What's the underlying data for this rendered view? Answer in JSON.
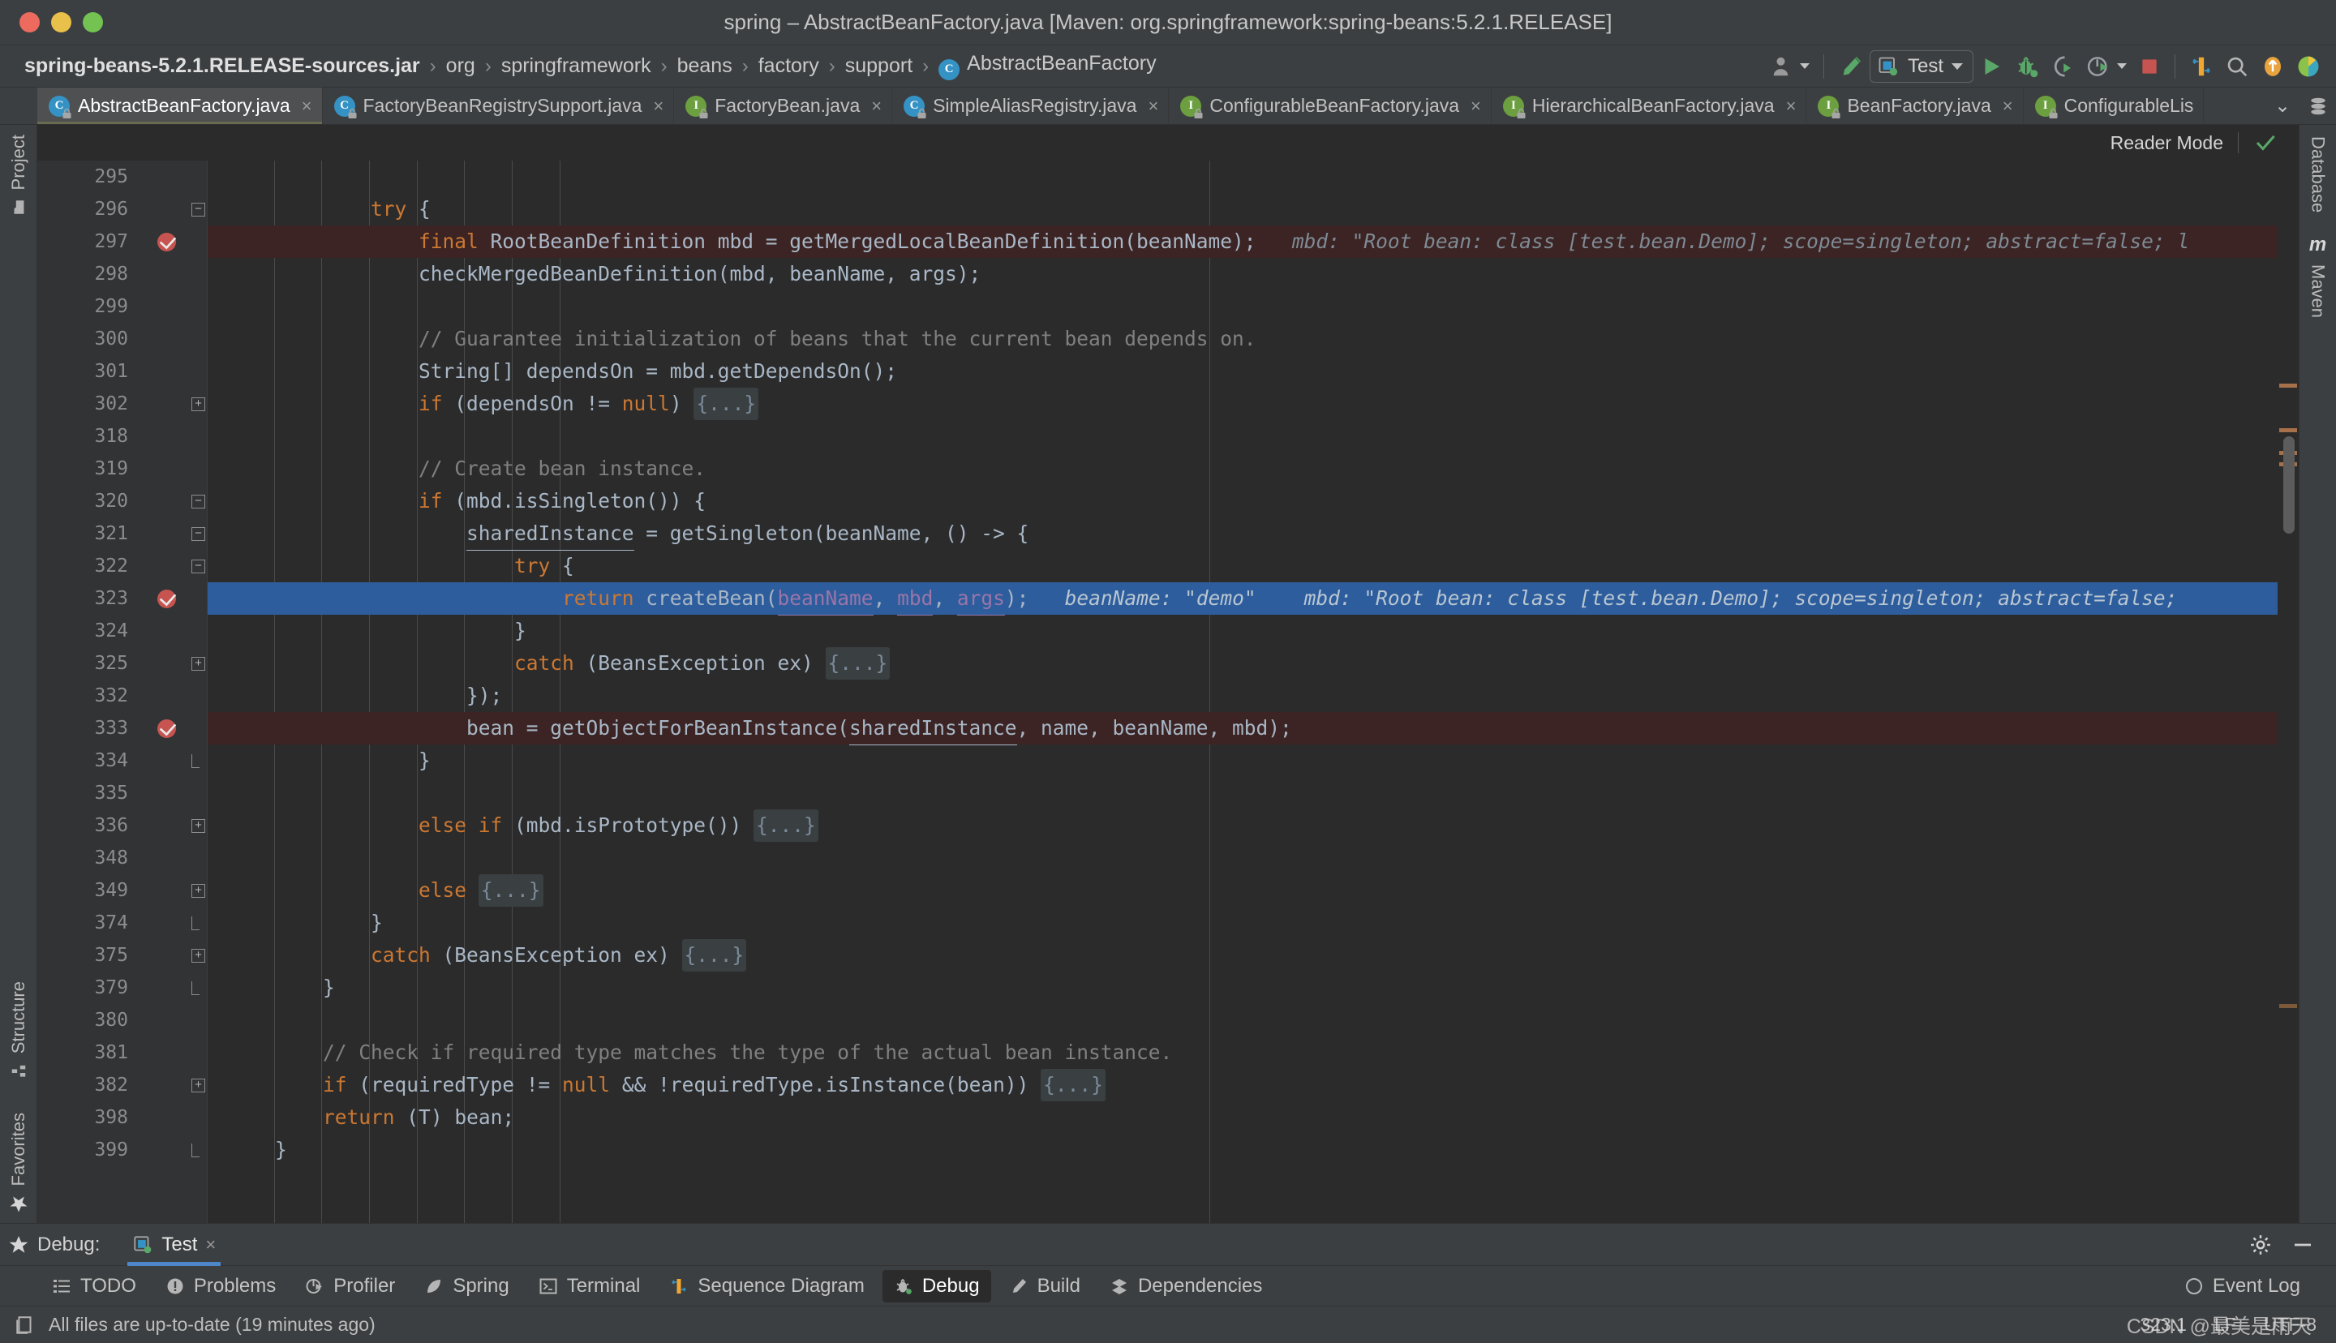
{
  "window": {
    "title": "spring – AbstractBeanFactory.java [Maven: org.springframework:spring-beans:5.2.1.RELEASE]",
    "close_label": "close-window",
    "minimize_label": "minimize-window",
    "maximize_label": "maximize-window"
  },
  "breadcrumb": {
    "items": [
      {
        "label": "spring-beans-5.2.1.RELEASE-sources.jar",
        "icon": "",
        "strong": true
      },
      {
        "label": "org",
        "icon": "",
        "strong": false
      },
      {
        "label": "springframework",
        "icon": "",
        "strong": false
      },
      {
        "label": "beans",
        "icon": "",
        "strong": false
      },
      {
        "label": "factory",
        "icon": "",
        "strong": false
      },
      {
        "label": "support",
        "icon": "",
        "strong": false
      },
      {
        "label": "AbstractBeanFactory",
        "icon": "class-icon",
        "strong": false
      }
    ],
    "separator": "›"
  },
  "toolbar": {
    "user_icon": "user-avatar-icon",
    "build_icon": "build-hammer-icon",
    "run_config": {
      "name": "Test",
      "icon": "run-config-icon"
    },
    "run_icon": "run-play-icon",
    "debug_icon": "debug-bug-icon",
    "run_coverage_icon": "run-with-coverage-icon",
    "profile_icon": "profiler-icon",
    "stop_icon": "stop-square-icon",
    "sequence_icon": "sequence-diagram-icon",
    "search_icon": "search-magnifier-icon",
    "update_icon": "update-project-icon",
    "ide_icon": "ide-feature-icon"
  },
  "tabs": {
    "items": [
      {
        "label": "AbstractBeanFactory.java",
        "kind": "c",
        "active": true,
        "locked": true
      },
      {
        "label": "FactoryBeanRegistrySupport.java",
        "kind": "c",
        "active": false,
        "locked": true
      },
      {
        "label": "FactoryBean.java",
        "kind": "i",
        "active": false,
        "locked": true
      },
      {
        "label": "SimpleAliasRegistry.java",
        "kind": "c",
        "active": false,
        "locked": true
      },
      {
        "label": "ConfigurableBeanFactory.java",
        "kind": "i",
        "active": false,
        "locked": true
      },
      {
        "label": "HierarchicalBeanFactory.java",
        "kind": "i",
        "active": false,
        "locked": true
      },
      {
        "label": "BeanFactory.java",
        "kind": "i",
        "active": false,
        "locked": true
      },
      {
        "label": "ConfigurableLis",
        "kind": "i",
        "active": false,
        "locked": true
      }
    ],
    "close_glyph": "×",
    "more_glyph": "⌄",
    "more_label": "show-hidden-tabs"
  },
  "reader_mode": {
    "label": "Reader Mode",
    "status_icon": "green-check-icon"
  },
  "left_sidebar": {
    "top": [
      {
        "label": "Project",
        "icon": "project-folder-icon"
      }
    ],
    "bottom": [
      {
        "label": "Structure",
        "icon": "structure-icon"
      },
      {
        "label": "Favorites",
        "icon": "favorites-star-icon"
      }
    ]
  },
  "right_sidebar": {
    "items": [
      {
        "label": "Database",
        "icon": "database-icon"
      },
      {
        "label": "Maven",
        "icon": "maven-m-icon"
      }
    ]
  },
  "editor": {
    "lines": [
      {
        "n": "295",
        "indent": 0,
        "state": "normal",
        "breakpoint": false,
        "fold": "",
        "segments": []
      },
      {
        "n": "296",
        "indent": 0,
        "state": "normal",
        "breakpoint": false,
        "fold": "minus",
        "segments": [
          {
            "t": "            ",
            "c": "txt"
          },
          {
            "t": "try",
            "c": "kw"
          },
          {
            "t": " {",
            "c": "txt"
          }
        ]
      },
      {
        "n": "297",
        "indent": 0,
        "state": "err",
        "breakpoint": true,
        "fold": "",
        "segments": [
          {
            "t": "                ",
            "c": "txt"
          },
          {
            "t": "final",
            "c": "kw"
          },
          {
            "t": " RootBeanDefinition mbd = getMergedLocalBeanDefinition(beanName);",
            "c": "txt"
          },
          {
            "t": "   mbd: \"Root bean: class [test.bean.Demo]; scope=singleton; abstract=false; l",
            "c": "hint"
          }
        ]
      },
      {
        "n": "298",
        "indent": 0,
        "state": "normal",
        "breakpoint": false,
        "fold": "",
        "segments": [
          {
            "t": "                checkMergedBeanDefinition(mbd, beanName, args);",
            "c": "txt"
          }
        ]
      },
      {
        "n": "299",
        "indent": 0,
        "state": "normal",
        "breakpoint": false,
        "fold": "",
        "segments": []
      },
      {
        "n": "300",
        "indent": 0,
        "state": "normal",
        "breakpoint": false,
        "fold": "",
        "segments": [
          {
            "t": "                // Guarantee initialization of beans that the current bean depends on.",
            "c": "cmt"
          }
        ]
      },
      {
        "n": "301",
        "indent": 0,
        "state": "normal",
        "breakpoint": false,
        "fold": "",
        "segments": [
          {
            "t": "                String[] dependsOn = mbd.getDependsOn();",
            "c": "txt"
          }
        ]
      },
      {
        "n": "302",
        "indent": 0,
        "state": "normal",
        "breakpoint": false,
        "fold": "plus",
        "segments": [
          {
            "t": "                ",
            "c": "txt"
          },
          {
            "t": "if",
            "c": "kw"
          },
          {
            "t": " (dependsOn != ",
            "c": "txt"
          },
          {
            "t": "null",
            "c": "kw"
          },
          {
            "t": ") ",
            "c": "txt"
          },
          {
            "t": "{...}",
            "c": "fold-ph"
          }
        ]
      },
      {
        "n": "318",
        "indent": 0,
        "state": "normal",
        "breakpoint": false,
        "fold": "",
        "segments": []
      },
      {
        "n": "319",
        "indent": 0,
        "state": "normal",
        "breakpoint": false,
        "fold": "",
        "segments": [
          {
            "t": "                // Create bean instance.",
            "c": "cmt"
          }
        ]
      },
      {
        "n": "320",
        "indent": 0,
        "state": "normal",
        "breakpoint": false,
        "fold": "minus",
        "segments": [
          {
            "t": "                ",
            "c": "txt"
          },
          {
            "t": "if",
            "c": "kw"
          },
          {
            "t": " (mbd.isSingleton()) {",
            "c": "txt"
          }
        ]
      },
      {
        "n": "321",
        "indent": 0,
        "state": "normal",
        "breakpoint": false,
        "fold": "minus",
        "segments": [
          {
            "t": "                    ",
            "c": "txt"
          },
          {
            "t": "sharedInstance",
            "c": "local-u"
          },
          {
            "t": " = getSingleton(beanName, () -> {",
            "c": "txt"
          }
        ]
      },
      {
        "n": "322",
        "indent": 0,
        "state": "normal",
        "breakpoint": false,
        "fold": "minus",
        "segments": [
          {
            "t": "                        ",
            "c": "txt"
          },
          {
            "t": "try",
            "c": "kw"
          },
          {
            "t": " {",
            "c": "txt"
          }
        ]
      },
      {
        "n": "323",
        "indent": 0,
        "state": "exec",
        "breakpoint": true,
        "fold": "",
        "segments": [
          {
            "t": "                            ",
            "c": "txt"
          },
          {
            "t": "return",
            "c": "kw"
          },
          {
            "t": " createBean(",
            "c": "txt"
          },
          {
            "t": "beanName",
            "c": "param"
          },
          {
            "t": ", ",
            "c": "txt"
          },
          {
            "t": "mbd",
            "c": "param"
          },
          {
            "t": ", ",
            "c": "txt"
          },
          {
            "t": "args",
            "c": "param"
          },
          {
            "t": ");",
            "c": "txt"
          },
          {
            "t": "   beanName: \"demo\"    mbd: \"Root bean: class [test.bean.Demo]; scope=singleton; abstract=false;",
            "c": "hint-light"
          }
        ]
      },
      {
        "n": "324",
        "indent": 0,
        "state": "normal",
        "breakpoint": false,
        "fold": "",
        "segments": [
          {
            "t": "                        }",
            "c": "txt"
          }
        ]
      },
      {
        "n": "325",
        "indent": 0,
        "state": "normal",
        "breakpoint": false,
        "fold": "plus",
        "segments": [
          {
            "t": "                        ",
            "c": "txt"
          },
          {
            "t": "catch",
            "c": "kw"
          },
          {
            "t": " (BeansException ex) ",
            "c": "txt"
          },
          {
            "t": "{...}",
            "c": "fold-ph"
          }
        ]
      },
      {
        "n": "332",
        "indent": 0,
        "state": "normal",
        "breakpoint": false,
        "fold": "",
        "segments": [
          {
            "t": "                    });",
            "c": "txt"
          }
        ]
      },
      {
        "n": "333",
        "indent": 0,
        "state": "err",
        "breakpoint": true,
        "fold": "",
        "segments": [
          {
            "t": "                    bean = getObjectForBeanInstance(",
            "c": "txt"
          },
          {
            "t": "sharedInstance",
            "c": "local-u"
          },
          {
            "t": ", name, beanName, mbd);",
            "c": "txt"
          }
        ]
      },
      {
        "n": "334",
        "indent": 0,
        "state": "normal",
        "breakpoint": false,
        "fold": "bracket-end",
        "segments": [
          {
            "t": "                }",
            "c": "txt"
          }
        ]
      },
      {
        "n": "335",
        "indent": 0,
        "state": "normal",
        "breakpoint": false,
        "fold": "",
        "segments": []
      },
      {
        "n": "336",
        "indent": 0,
        "state": "normal",
        "breakpoint": false,
        "fold": "plus",
        "segments": [
          {
            "t": "                ",
            "c": "txt"
          },
          {
            "t": "else if",
            "c": "kw"
          },
          {
            "t": " (mbd.isPrototype()) ",
            "c": "txt"
          },
          {
            "t": "{...}",
            "c": "fold-ph"
          }
        ]
      },
      {
        "n": "348",
        "indent": 0,
        "state": "normal",
        "breakpoint": false,
        "fold": "",
        "segments": []
      },
      {
        "n": "349",
        "indent": 0,
        "state": "normal",
        "breakpoint": false,
        "fold": "plus",
        "segments": [
          {
            "t": "                ",
            "c": "txt"
          },
          {
            "t": "else",
            "c": "kw"
          },
          {
            "t": " ",
            "c": "txt"
          },
          {
            "t": "{...}",
            "c": "fold-ph"
          }
        ]
      },
      {
        "n": "374",
        "indent": 0,
        "state": "normal",
        "breakpoint": false,
        "fold": "bracket-end",
        "segments": [
          {
            "t": "            }",
            "c": "txt"
          }
        ]
      },
      {
        "n": "375",
        "indent": 0,
        "state": "normal",
        "breakpoint": false,
        "fold": "plus",
        "segments": [
          {
            "t": "            ",
            "c": "txt"
          },
          {
            "t": "catch",
            "c": "kw"
          },
          {
            "t": " (BeansException ex) ",
            "c": "txt"
          },
          {
            "t": "{...}",
            "c": "fold-ph"
          }
        ]
      },
      {
        "n": "379",
        "indent": 0,
        "state": "normal",
        "breakpoint": false,
        "fold": "bracket-end",
        "segments": [
          {
            "t": "        }",
            "c": "txt"
          }
        ]
      },
      {
        "n": "380",
        "indent": 0,
        "state": "normal",
        "breakpoint": false,
        "fold": "",
        "segments": []
      },
      {
        "n": "381",
        "indent": 0,
        "state": "normal",
        "breakpoint": false,
        "fold": "",
        "segments": [
          {
            "t": "        // Check if required type matches the type of the actual bean instance.",
            "c": "cmt"
          }
        ]
      },
      {
        "n": "382",
        "indent": 0,
        "state": "normal",
        "breakpoint": false,
        "fold": "plus",
        "segments": [
          {
            "t": "        ",
            "c": "txt"
          },
          {
            "t": "if",
            "c": "kw"
          },
          {
            "t": " (requiredType != ",
            "c": "txt"
          },
          {
            "t": "null",
            "c": "kw"
          },
          {
            "t": " && !requiredType.isInstance(bean)) ",
            "c": "txt"
          },
          {
            "t": "{...}",
            "c": "fold-ph"
          }
        ]
      },
      {
        "n": "398",
        "indent": 0,
        "state": "normal",
        "breakpoint": false,
        "fold": "",
        "segments": [
          {
            "t": "        ",
            "c": "txt"
          },
          {
            "t": "return",
            "c": "kw"
          },
          {
            "t": " (",
            "c": "txt"
          },
          {
            "t": "T",
            "c": "txt"
          },
          {
            "t": ") bean;",
            "c": "txt"
          }
        ]
      },
      {
        "n": "399",
        "indent": 0,
        "state": "normal",
        "breakpoint": false,
        "fold": "bracket-end",
        "segments": [
          {
            "t": "    }",
            "c": "txt"
          }
        ]
      }
    ]
  },
  "debug_panel": {
    "title": "Debug:",
    "tab": {
      "label": "Test",
      "icon": "run-config-icon",
      "close_glyph": "×"
    },
    "settings_icon": "gear-icon",
    "minimize_icon": "minimize-icon"
  },
  "bottom_tools": {
    "items": [
      {
        "label": "TODO",
        "icon": "todo-list-icon",
        "active": false
      },
      {
        "label": "Problems",
        "icon": "problems-icon",
        "active": false
      },
      {
        "label": "Profiler",
        "icon": "profiler-icon",
        "active": false
      },
      {
        "label": "Spring",
        "icon": "spring-leaf-icon",
        "active": false
      },
      {
        "label": "Terminal",
        "icon": "terminal-icon",
        "active": false
      },
      {
        "label": "Sequence Diagram",
        "icon": "sequence-diagram-icon",
        "active": false
      },
      {
        "label": "Debug",
        "icon": "debug-bug-icon",
        "active": true
      },
      {
        "label": "Build",
        "icon": "build-hammer-icon",
        "active": false
      },
      {
        "label": "Dependencies",
        "icon": "dependencies-icon",
        "active": false
      }
    ],
    "event_log": {
      "label": "Event Log",
      "icon": "event-log-icon"
    }
  },
  "status_bar": {
    "message": "All files are up-to-date (19 minutes ago)",
    "message_icon": "file-sync-icon",
    "caret_position": "323:1",
    "line_separator": "LF",
    "encoding": "UTF-8",
    "watermark": "CSDN @最美是雨天"
  }
}
